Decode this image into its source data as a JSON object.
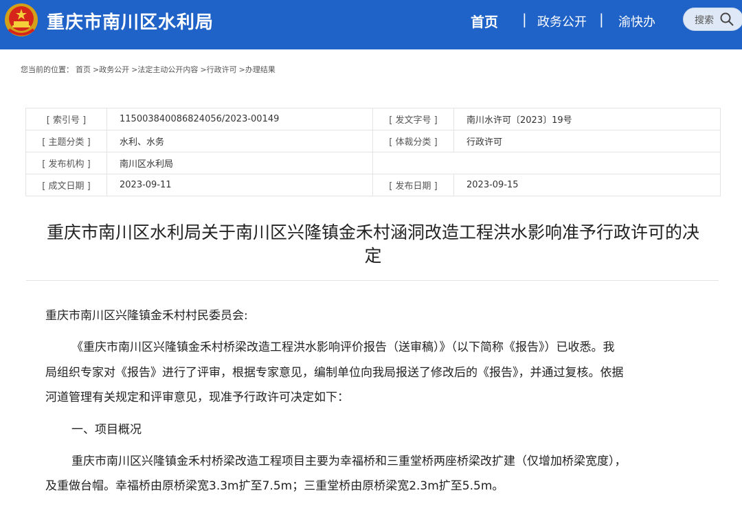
{
  "header": {
    "site_title": "重庆市南川区水利局",
    "nav": {
      "home": "首页",
      "sep1": "|",
      "open_gov": "政务公开",
      "sep2": "|",
      "yu_kuai_ban": "渝快办"
    },
    "search_label": "搜索",
    "colors": {
      "bar": "#1f62c8",
      "text": "#ffffff"
    }
  },
  "breadcrumb": {
    "prefix": "您当前的位置：",
    "items": [
      "首页",
      ">政务公开",
      ">法定主动公开内容",
      ">行政许可",
      ">办理结果"
    ]
  },
  "meta": {
    "index_label": "[ 索引号 ]",
    "index_value": "115003840086824056/2023-00149",
    "doc_no_label": "[ 发文字号 ]",
    "doc_no_value": "南川水许可〔2023〕19号",
    "topic_label": "[ 主题分类 ]",
    "topic_value": "水利、水务",
    "genre_label": "[ 体裁分类 ]",
    "genre_value": "行政许可",
    "publisher_label": "[ 发布机构 ]",
    "publisher_value": "南川区水利局",
    "written_label": "[ 成文日期 ]",
    "written_value": "2023-09-11",
    "published_label": "[ 发布日期 ]",
    "published_value": "2023-09-15"
  },
  "doc": {
    "title_line1": "重庆市南川区水利局关于南川区兴隆镇金禾村涵洞改造工程洪水影响准予行政许可的决",
    "title_line2": "定",
    "addressee": "重庆市南川区兴隆镇金禾村村民委员会:",
    "p1_l1": "《重庆市南川区兴隆镇金禾村桥梁改造工程洪水影响评价报告（送审稿）》（以下简称《报告》）已收悉。我",
    "p1_l2": "局组织专家对《报告》进行了评审，根据专家意见，编制单位向我局报送了修改后的《报告》，并通过复核。依据",
    "p1_l3": "河道管理有关规定和评审意见，现准予行政许可决定如下：",
    "section1": "一、项目概况",
    "p2_l1": "重庆市南川区兴隆镇金禾村桥梁改造工程项目主要为幸福桥和三重堂桥两座桥梁改扩建（仅增加桥梁宽度），",
    "p2_l2": "及重做台帽。幸福桥由原桥梁宽3.3m扩至7.5m；三重堂桥由原桥梁宽2.3m扩至5.5m。"
  }
}
